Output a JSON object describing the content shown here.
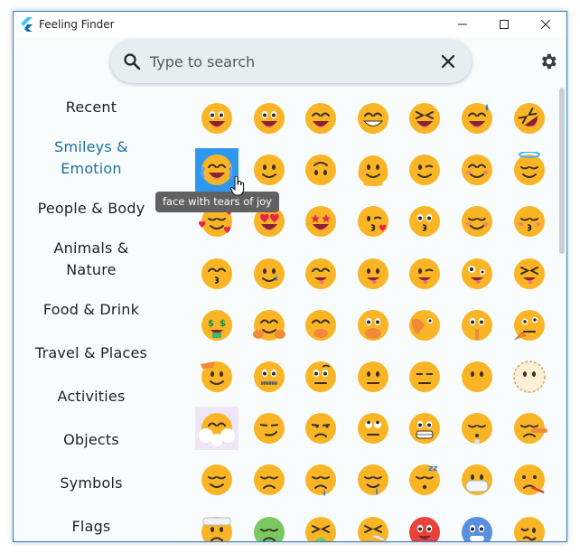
{
  "window": {
    "title": "Feeling Finder",
    "controls": [
      "minimize-icon",
      "maximize-icon",
      "close-icon"
    ]
  },
  "search": {
    "placeholder": "Type to search",
    "value": "",
    "icon": "search-icon",
    "clear_icon": "close-icon"
  },
  "settings": {
    "icon": "gear-icon"
  },
  "sidebar": {
    "categories": [
      {
        "label": "Recent",
        "active": false
      },
      {
        "label": "Smileys & Emotion",
        "active": true
      },
      {
        "label": "People & Body",
        "active": false
      },
      {
        "label": "Animals & Nature",
        "active": false
      },
      {
        "label": "Food & Drink",
        "active": false
      },
      {
        "label": "Travel & Places",
        "active": false
      },
      {
        "label": "Activities",
        "active": false
      },
      {
        "label": "Objects",
        "active": false
      },
      {
        "label": "Symbols",
        "active": false
      },
      {
        "label": "Flags",
        "active": false
      }
    ]
  },
  "tooltip": {
    "text": "face with tears of joy"
  },
  "emoji_grid": {
    "columns": 7,
    "selected_index": 7,
    "items": [
      "grinning-face",
      "grinning-face-big-eyes",
      "grinning-face-smiling-eyes",
      "beaming-face",
      "grinning-squinting-face",
      "grinning-face-sweat",
      "rolling-on-the-floor-laughing",
      "face-with-tears-of-joy",
      "slightly-smiling-face",
      "upside-down-face",
      "melting-face",
      "winking-face",
      "smiling-face-smiling-eyes",
      "smiling-face-with-halo",
      "smiling-face-with-hearts",
      "smiling-face-with-heart-eyes",
      "star-struck",
      "face-blowing-a-kiss",
      "kissing-face",
      "smiling-face",
      "kissing-face-closed-eyes",
      "kissing-face-smiling-eyes",
      "smiling-face-with-tear",
      "face-savoring-food",
      "face-with-tongue",
      "winking-face-with-tongue",
      "zany-face",
      "squinting-face-with-tongue",
      "money-mouth-face",
      "smiling-face-open-hands",
      "face-with-hand-over-mouth",
      "face-open-eyes-hand-over-mouth",
      "face-with-peeking-eye",
      "shushing-face",
      "thinking-face",
      "saluting-face",
      "zipper-mouth-face",
      "face-raised-eyebrow",
      "neutral-face",
      "expressionless-face",
      "face-without-mouth",
      "dotted-line-face",
      "face-in-clouds",
      "smirking-face",
      "unamused-face",
      "face-with-rolling-eyes",
      "grimacing-face",
      "face-exhaling",
      "lying-face",
      "relieved-face",
      "pensive-face",
      "sleepy-face",
      "drooling-face",
      "sleeping-face",
      "face-with-medical-mask",
      "face-with-thermometer",
      "face-with-head-bandage",
      "nauseated-face",
      "vomiting-face",
      "sneezing-face",
      "hot-face",
      "cold-face",
      "woozy-face"
    ]
  },
  "colors": {
    "accent": "#2f97ee",
    "active_category": "#1e6f9e",
    "search_bg": "#e4eef3",
    "emoji_yellow": "#f9b526",
    "tooltip_bg": "#616161"
  }
}
